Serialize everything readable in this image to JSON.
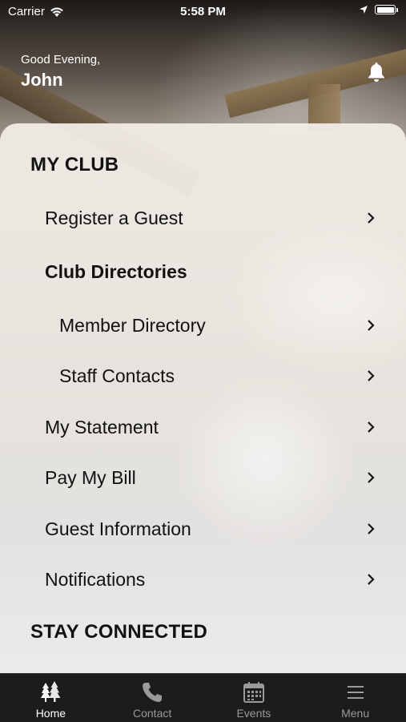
{
  "status_bar": {
    "carrier": "Carrier",
    "time": "5:58 PM"
  },
  "header": {
    "greeting": "Good Evening,",
    "name": "John"
  },
  "sections": {
    "my_club": "MY CLUB",
    "stay_connected": "STAY CONNECTED"
  },
  "menu": {
    "register_guest": "Register a Guest",
    "club_directories": "Club Directories",
    "member_directory": "Member Directory",
    "staff_contacts": "Staff Contacts",
    "my_statement": "My Statement",
    "pay_my_bill": "Pay My Bill",
    "guest_information": "Guest Information",
    "notifications": "Notifications"
  },
  "tabs": {
    "home": "Home",
    "contact": "Contact",
    "events": "Events",
    "menu": "Menu"
  },
  "colors": {
    "tabbar_bg": "#1c1c1c",
    "tab_active": "#ffffff",
    "tab_inactive": "#9a9a9a",
    "text": "#111111"
  },
  "icons": {
    "wifi": "wifi-icon",
    "location": "location-arrow-icon",
    "battery": "battery-icon",
    "bell": "bell-icon",
    "chevron": "chevron-right-icon",
    "home": "trees-icon",
    "contact": "phone-icon",
    "events": "calendar-icon",
    "menu": "hamburger-icon"
  }
}
